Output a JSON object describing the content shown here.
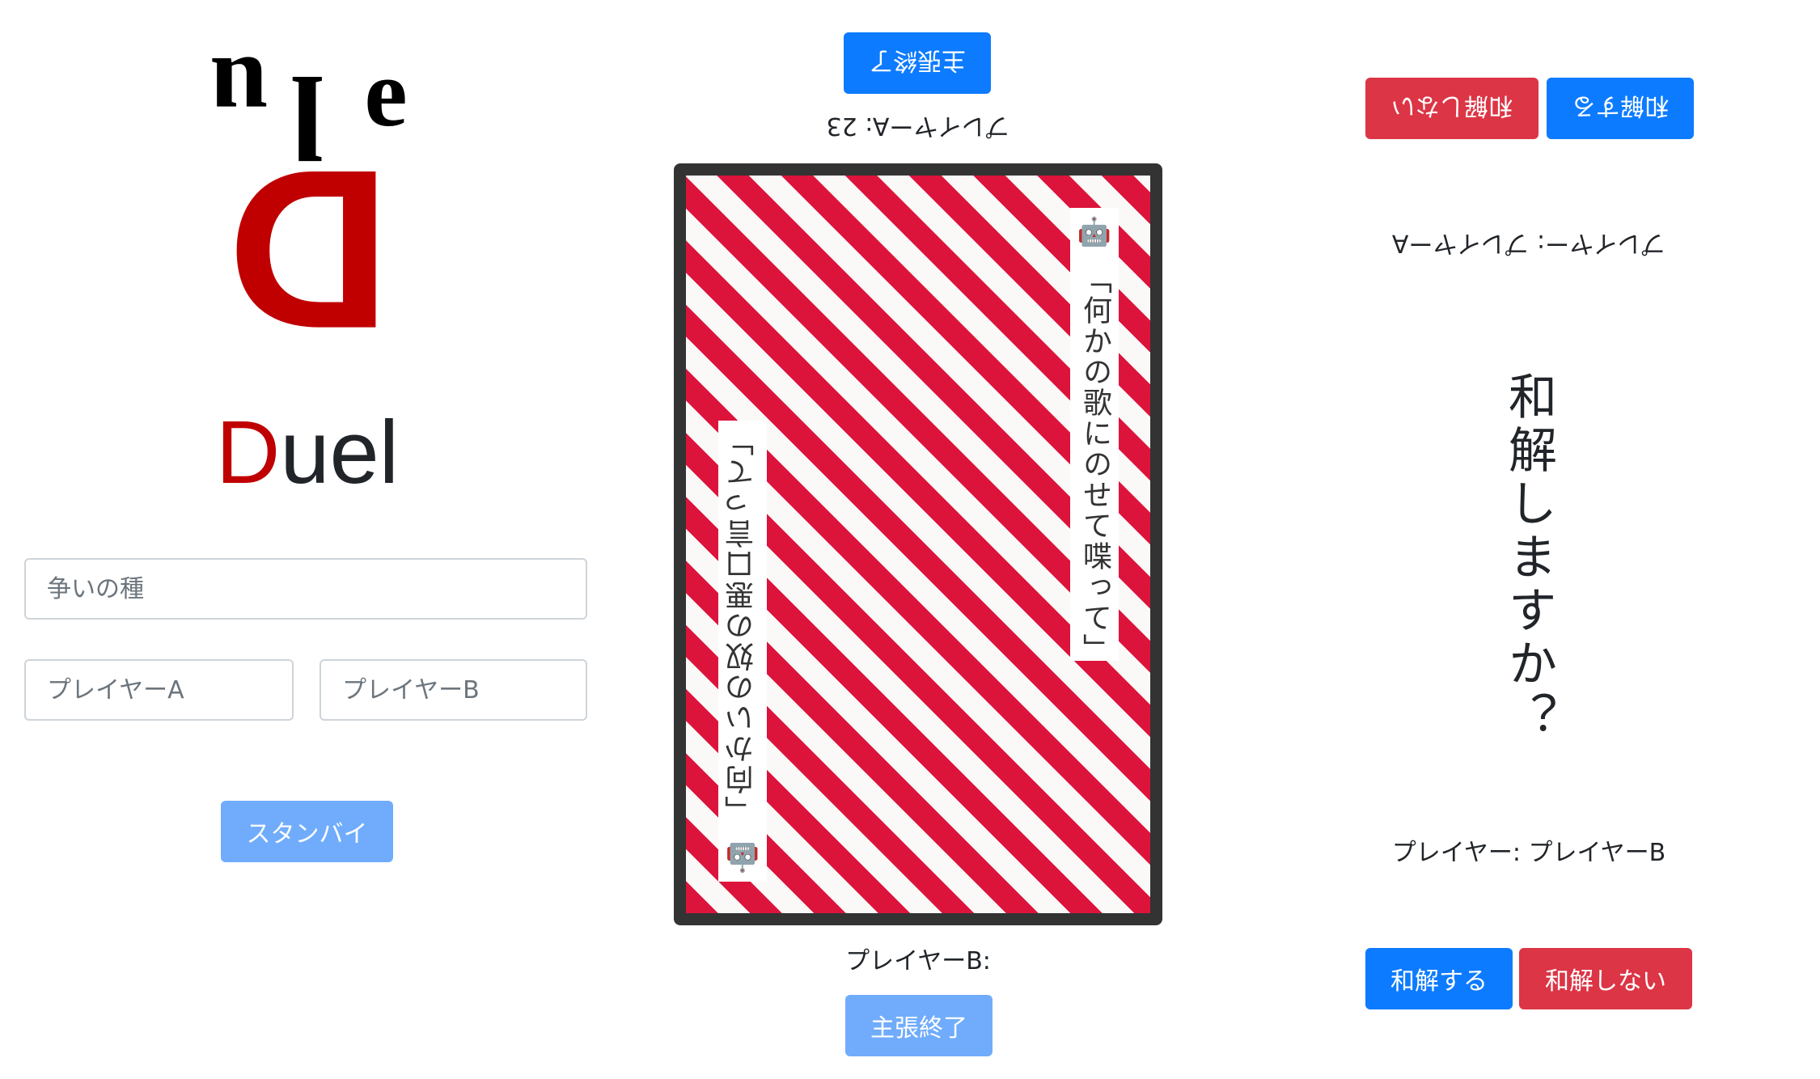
{
  "logo": {
    "letters": [
      "D",
      "u",
      "l",
      "e"
    ],
    "accent_color": "#c00000"
  },
  "app_title": {
    "first": "D",
    "rest": "uel"
  },
  "form": {
    "topic_placeholder": "争いの種",
    "player_a_placeholder": "プレイヤーA",
    "player_b_placeholder": "プレイヤーB",
    "standby_label": "スタンバイ"
  },
  "center": {
    "top_end_label": "主張終了",
    "top_player_label": "プレイヤーA: 23",
    "bottom_player_label": "プレイヤーB:",
    "bottom_end_label": "主張終了",
    "speech_b": {
      "icon": "robot-icon",
      "emoji": "🤖",
      "text": "「何かの歌にのせて喋って」"
    },
    "speech_a": {
      "icon": "robot-icon",
      "emoji": "🤖",
      "text": "「向かいの奴の悪口言って」"
    },
    "stripe_colors": [
      "#dc143c",
      "#fbf8f8"
    ]
  },
  "right": {
    "top_accept_label": "和解する",
    "top_reject_label": "和解しない",
    "top_player_name": "プレイヤー: プレイヤーA",
    "question": "和解しますか？",
    "bottom_player_name": "プレイヤー: プレイヤーB",
    "bottom_accept_label": "和解する",
    "bottom_reject_label": "和解しない"
  },
  "colors": {
    "primary": "#0d7bff",
    "primary_disabled": "#70acfb",
    "danger": "#dc3545",
    "card_border": "#333333"
  }
}
